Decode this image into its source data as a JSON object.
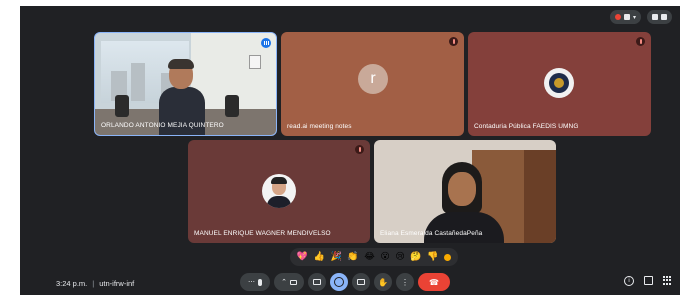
{
  "tiles": [
    {
      "name": "ORLANDO ANTONIO MEJIA QUINTERO"
    },
    {
      "name": "read.ai meeting notes",
      "avatar_letter": "r"
    },
    {
      "name": "Contaduria Pública FAEDIS UMNG"
    },
    {
      "name": "MANUEL ENRIQUE WAGNER MENDIVELSO"
    },
    {
      "name": "Eliana Esmeralda CastañedaPeña"
    }
  ],
  "footer": {
    "time": "3:24 p.m.",
    "separator": "|",
    "meeting_code": "utn-ifrw-inf"
  },
  "reactions": [
    "💖",
    "👍",
    "🎉",
    "👏",
    "😂",
    "😮",
    "😢",
    "🤔",
    "👎"
  ],
  "controls": {
    "more_label": "⋯",
    "chevron_label": "⌃",
    "more_options_label": "⋮",
    "info_label": "i",
    "hangup_label": "☎"
  },
  "colors": {
    "meet_bg": "#202124",
    "tile_readai": "#a25f45",
    "tile_contaduria": "#84403b",
    "tile_manuel": "#6a3a38",
    "active_accent": "#8ab4f8",
    "hangup": "#ea4335"
  }
}
